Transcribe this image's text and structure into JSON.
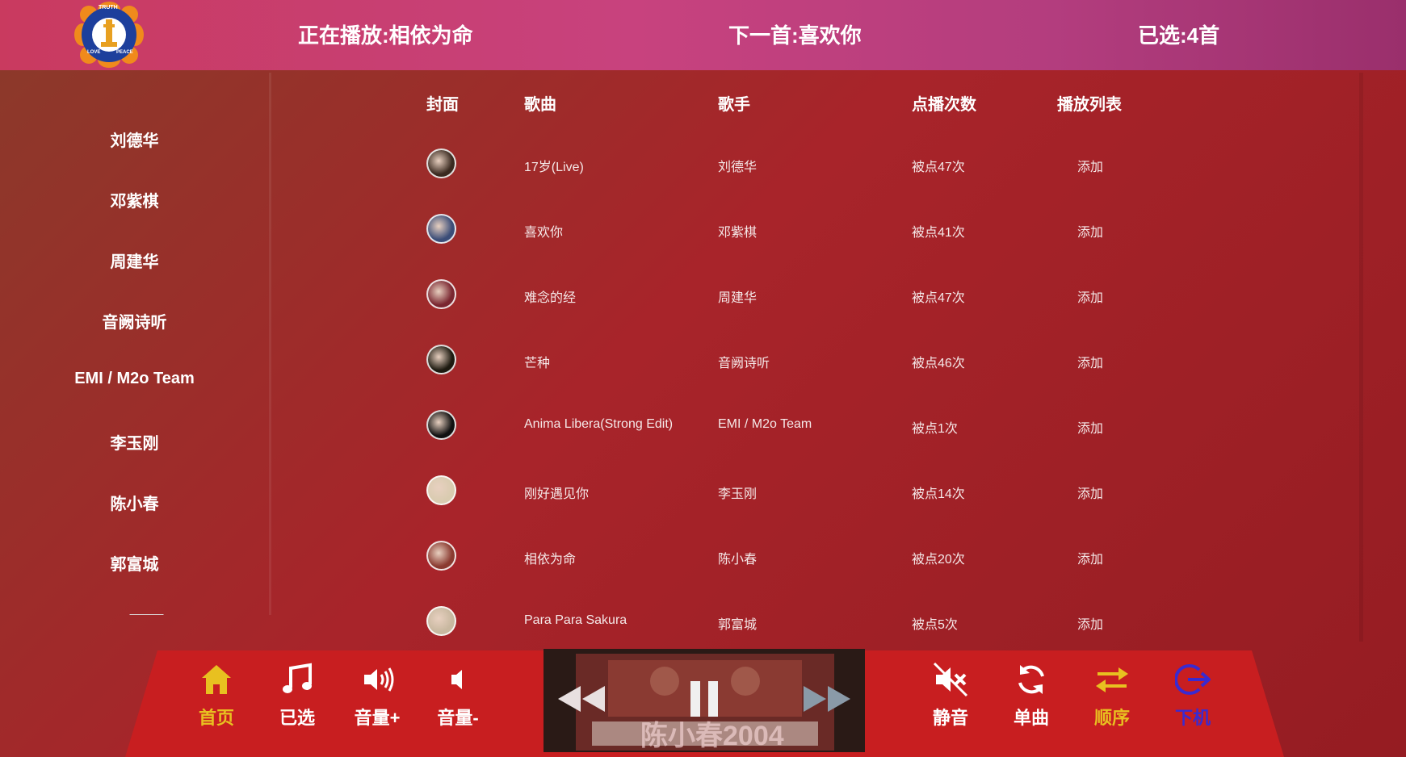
{
  "header": {
    "now_playing_label": "正在播放:",
    "now_playing_song": "相依为命",
    "next_label": "下一首:",
    "next_song": "喜欢你",
    "selected_label": "已选:",
    "selected_count": "4首",
    "logo_text_top": "TRUTH",
    "logo_text_left": "LOVE",
    "logo_text_right": "PEACE"
  },
  "sidebar": {
    "items": [
      "刘德华",
      "邓紫棋",
      "周建华",
      "音阙诗听",
      "EMI / M2o Team",
      "李玉刚",
      "陈小春",
      "郭富城"
    ],
    "more": "———"
  },
  "table": {
    "headers": {
      "cover": "封面",
      "song": "歌曲",
      "singer": "歌手",
      "plays": "点播次数",
      "playlist": "播放列表"
    },
    "rows": [
      {
        "song": "17岁(Live)",
        "singer": "刘德华",
        "plays": "被点47次",
        "action": "添加",
        "cover_color": "#3a2a20"
      },
      {
        "song": "喜欢你",
        "singer": "邓紫棋",
        "plays": "被点41次",
        "action": "添加",
        "cover_color": "#3b4d78"
      },
      {
        "song": "难念的经",
        "singer": "周建华",
        "plays": "被点47次",
        "action": "添加",
        "cover_color": "#7a2630"
      },
      {
        "song": "芒种",
        "singer": "音阙诗听",
        "plays": "被点46次",
        "action": "添加",
        "cover_color": "#1d1a10"
      },
      {
        "song": "Anima Libera(Strong Edit)",
        "singer": "EMI / M2o Team",
        "plays": "被点1次",
        "action": "添加",
        "cover_color": "#111111"
      },
      {
        "song": "刚好遇见你",
        "singer": "李玉刚",
        "plays": "被点14次",
        "action": "添加",
        "cover_color": "#d9cbb0"
      },
      {
        "song": "相依为命",
        "singer": "陈小春",
        "plays": "被点20次",
        "action": "添加",
        "cover_color": "#8a3a30"
      },
      {
        "song": "Para Para Sakura",
        "singer": "郭富城",
        "plays": "被点5次",
        "action": "添加",
        "cover_color": "#c8b8a0"
      }
    ]
  },
  "controls": {
    "home": "首页",
    "selected": "已选",
    "vol_up": "音量+",
    "vol_down": "音量-",
    "mute": "静音",
    "single": "单曲",
    "order": "顺序",
    "off": "下机"
  },
  "album": {
    "text": "陈小春2004"
  },
  "colors": {
    "header_start": "#c93a5f",
    "header_end": "#9a2f6c",
    "bar": "#c81e20",
    "highlight_yellow": "#e8c020",
    "exit_blue": "#3a2ad0"
  }
}
